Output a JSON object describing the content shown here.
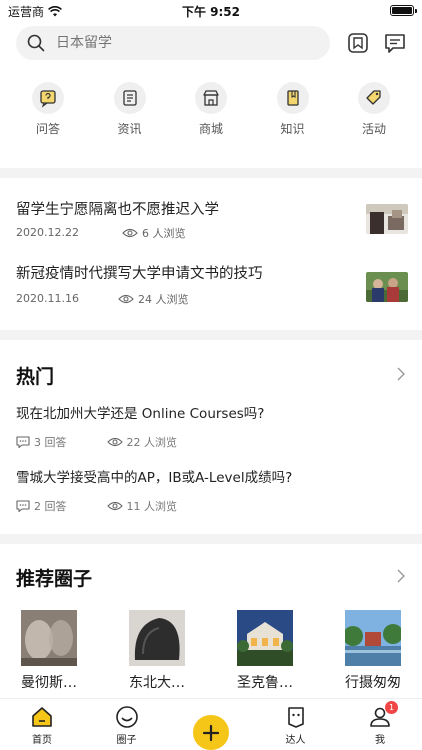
{
  "status_bar": {
    "carrier": "运营商",
    "time": "下午 9:52"
  },
  "search": {
    "placeholder": "日本留学"
  },
  "categories": [
    {
      "label": "问答",
      "icon": "qa-icon"
    },
    {
      "label": "资讯",
      "icon": "news-icon"
    },
    {
      "label": "商城",
      "icon": "shop-icon"
    },
    {
      "label": "知识",
      "icon": "book-icon"
    },
    {
      "label": "活动",
      "icon": "tag-icon"
    }
  ],
  "articles": [
    {
      "title": "留学生宁愿隔离也不愿推迟入学",
      "date": "2020.12.22",
      "views": "6 人浏览"
    },
    {
      "title": "新冠疫情时代撰写大学申请文书的技巧",
      "date": "2020.11.16",
      "views": "24 人浏览"
    }
  ],
  "hot": {
    "title": "热门",
    "questions": [
      {
        "question": "现在北加州大学还是 Online Courses吗?",
        "answers": "3 回答",
        "views": "22 人浏览"
      },
      {
        "question": "雪城大学接受高中的AP，IB或A-Level成绩吗?",
        "answers": "2 回答",
        "views": "11 人浏览"
      }
    ]
  },
  "circles_section": {
    "title": "推荐圈子",
    "items": [
      {
        "name": "曼彻斯…"
      },
      {
        "name": "东北大…"
      },
      {
        "name": "圣克鲁…"
      },
      {
        "name": "行摄匆匆"
      }
    ]
  },
  "tabbar": {
    "items": [
      {
        "label": "首页"
      },
      {
        "label": "圈子"
      },
      {
        "label": ""
      },
      {
        "label": "达人"
      },
      {
        "label": "我",
        "badge": "1"
      }
    ]
  },
  "colors": {
    "accent": "#f5c518",
    "badge": "#f04646"
  }
}
